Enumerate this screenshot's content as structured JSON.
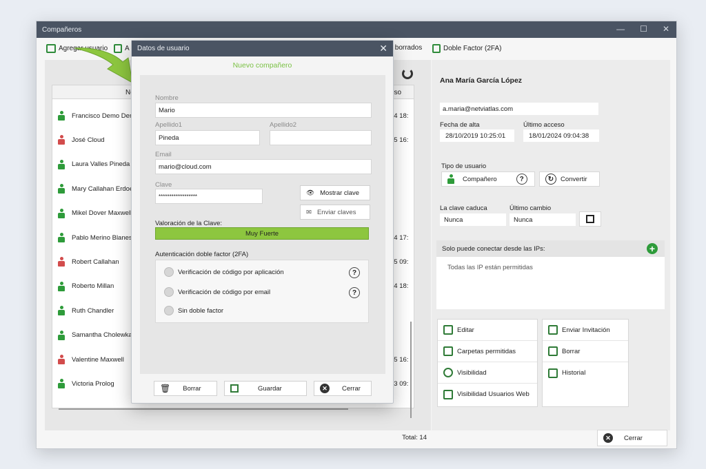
{
  "window": {
    "title": "Compañeros",
    "toolbar": {
      "add_user": "Agregar usuario",
      "a_partial": "A",
      "deleted": "s borrados",
      "two_factor": "Doble Factor (2FA)"
    }
  },
  "list": {
    "header_name": "No",
    "header_access": "eso",
    "rows": [
      {
        "name": "Francisco Demo Dem",
        "date": "24 18:",
        "status": "green"
      },
      {
        "name": "José Cloud",
        "date": "25 16:",
        "status": "red"
      },
      {
        "name": "Laura Valles Pineda",
        "date": "",
        "status": "green"
      },
      {
        "name": "Mary Callahan Erdoes",
        "date": "",
        "status": "green"
      },
      {
        "name": "Mikel Dover Maxwell",
        "date": "",
        "status": "green"
      },
      {
        "name": "Pablo Merino Blanes",
        "date": "24 17:",
        "status": "green"
      },
      {
        "name": "Robert Callahan",
        "date": "25 09:",
        "status": "red"
      },
      {
        "name": "Roberto Millan",
        "date": "24 18:",
        "status": "green"
      },
      {
        "name": "Ruth Chandler",
        "date": "",
        "status": "green"
      },
      {
        "name": "Samantha Cholewka",
        "date": "",
        "status": "green"
      },
      {
        "name": "Valentine Maxwell",
        "date": "25 16:",
        "status": "red"
      },
      {
        "name": "Victoria Prolog",
        "date": "23 09:",
        "status": "green"
      }
    ],
    "total": "Total: 14"
  },
  "detail": {
    "name": "Ana María García López",
    "email": "a.maria@netviatlas.com",
    "created_label": "Fecha de alta",
    "created_value": "28/10/2019 10:25:01",
    "last_access_label": "Último acceso",
    "last_access_value": "18/01/2024 09:04:38",
    "user_type_label": "Tipo de usuario",
    "user_type_value": "Compañero",
    "help_glyph": "?",
    "convert_label": "Convertir",
    "password_expires_label": "La clave caduca",
    "password_expires_value": "Nunca",
    "last_change_label": "Último cambio",
    "last_change_value": "Nunca",
    "ip_header": "Solo puede conectar desde las IPs:",
    "ip_empty": "Todas las IP están permitidas",
    "actions_left": [
      "Editar",
      "Carpetas permitidas",
      "Visibilidad",
      "Visibilidad Usuarios Web"
    ],
    "actions_right": [
      "Enviar Invitación",
      "Borrar",
      "Historial"
    ],
    "close_label": "Cerrar"
  },
  "dialog": {
    "title": "Datos de usuario",
    "subtitle": "Nuevo compañero",
    "name_label": "Nombre",
    "name_value": "Mario",
    "surname1_label": "Apellido1",
    "surname1_value": "Pineda",
    "surname2_label": "Apellido2",
    "surname2_value": "",
    "email_label": "Email",
    "email_value": "mario@cloud.com",
    "password_label": "Clave",
    "password_value": "******************",
    "show_password": "Mostrar clave",
    "send_passwords": "Enviar claves",
    "strength_label": "Valoración de la Clave:",
    "strength_value": "Muy Fuerte",
    "tfa_label": "Autenticación doble factor (2FA)",
    "tfa_options": [
      "Verificación de código por aplicación",
      "Verificación de código por email",
      "Sin doble factor"
    ],
    "btn_delete": "Borrar",
    "btn_save": "Guardar",
    "btn_close": "Cerrar",
    "accent_color": "#7ac143"
  }
}
